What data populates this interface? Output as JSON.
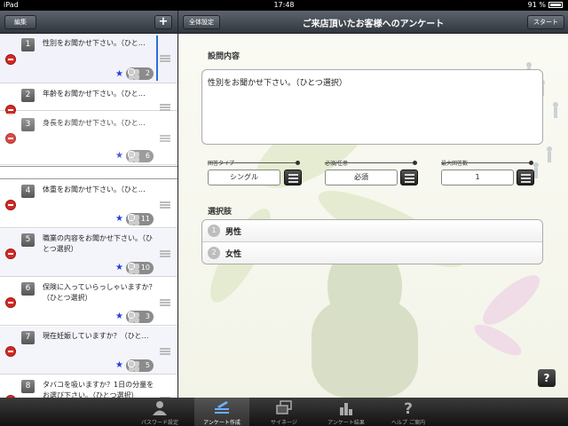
{
  "statusbar": {
    "device": "iPad",
    "time": "17:48",
    "battery": "91 %"
  },
  "left_nav": {
    "edit_label": "編集",
    "add_label": "+"
  },
  "right_nav": {
    "settings_label": "全体設定",
    "title": "ご来店頂いたお客様へのアンケート",
    "start_label": "スタート"
  },
  "questions": [
    {
      "num": "1",
      "text": "性別をお聞かせ下さい。（ひと…",
      "required": true,
      "choices": "2",
      "selected": true
    },
    {
      "num": "2",
      "text": "年齢をお聞かせ下さい。（ひと…",
      "required": false,
      "choices": ""
    },
    {
      "num": "3",
      "text": "身長をお聞かせ下さい。（ひと…",
      "required": true,
      "choices": "6"
    },
    {
      "num": "4",
      "text": "体重をお聞かせ下さい。（ひと…",
      "required": true,
      "choices": "11"
    },
    {
      "num": "5",
      "text": "職業の内容をお聞かせ下さい。（ひとつ選択）",
      "required": true,
      "choices": "10"
    },
    {
      "num": "6",
      "text": "保険に入っていらっしゃいますか？（ひとつ選択）",
      "required": true,
      "choices": "3"
    },
    {
      "num": "7",
      "text": "現在妊娠していますか？（ひと…",
      "required": true,
      "choices": "5"
    },
    {
      "num": "8",
      "text": "タバコを吸いますか？1日の分量をお選び下さい。（ひとつ選択）",
      "required": false,
      "choices": ""
    }
  ],
  "editor": {
    "question_label": "設問内容",
    "question_text": "性別をお聞かせ下さい。（ひとつ選択）",
    "answer_type_label": "回答タイプ",
    "answer_type_value": "シングル",
    "required_label": "必須/任意",
    "required_value": "必須",
    "max_answers_label": "最大回答数",
    "max_answers_value": "1",
    "choices_label": "選択肢",
    "choices": [
      {
        "num": "1",
        "text": "男性"
      },
      {
        "num": "2",
        "text": "女性"
      }
    ],
    "help_label": "?"
  },
  "tabbar": {
    "tabs": [
      {
        "label": "パスワード設定",
        "icon": "person-icon"
      },
      {
        "label": "アンケート作成",
        "icon": "edit-list-icon",
        "active": true
      },
      {
        "label": "サイネージ",
        "icon": "screens-icon"
      },
      {
        "label": "アンケート結果",
        "icon": "bar-chart-icon"
      },
      {
        "label": "ヘルプ ご案内",
        "icon": "help-icon"
      }
    ]
  },
  "colors": {
    "accent": "#2d6fd4",
    "delete": "#d42a24",
    "required_star": "#2240d8"
  }
}
